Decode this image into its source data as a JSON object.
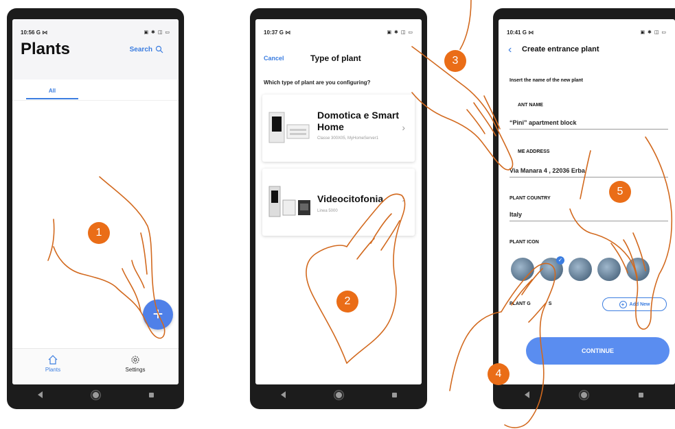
{
  "phone1": {
    "status_time": "10:56",
    "status_carrier": "G ⋈",
    "title": "Plants",
    "search_label": "Search",
    "tab_all": "All",
    "fab_label": "+",
    "bottom_plants": "Plants",
    "bottom_settings": "Settings"
  },
  "phone2": {
    "status_time": "10:37",
    "status_carrier": "G ⋈",
    "cancel": "Cancel",
    "title": "Type of plant",
    "question": "Which type of plant are you configuring?",
    "cards": [
      {
        "title": "Domotica e Smart Home",
        "subtitle": "Classe 300X05, MyHomeServer1"
      },
      {
        "title": "Videocitofonia",
        "subtitle": "Linea 5000"
      }
    ]
  },
  "phone3": {
    "status_time": "10:41",
    "status_carrier": "G ⋈",
    "title": "Create entrance plant",
    "instruction": "Insert the name of the new plant",
    "name_label": "ANT NAME",
    "name_value": "“Pini” apartment block",
    "address_label": "ME ADDRESS",
    "address_value": "Via Manara 4 , 22036 Erba",
    "country_label": "PLANT COUNTRY",
    "country_value": "Italy",
    "icon_label": "PLANT ICON",
    "group_label": "PLANT G",
    "group_label_tail": "S",
    "add_new": "Add New",
    "continue": "CONTINUE"
  },
  "steps": [
    "1",
    "2",
    "3",
    "4",
    "5"
  ],
  "colors": {
    "accent": "#3b7de0",
    "badge": "#ea6d17",
    "hand_stroke": "#d2691e"
  }
}
